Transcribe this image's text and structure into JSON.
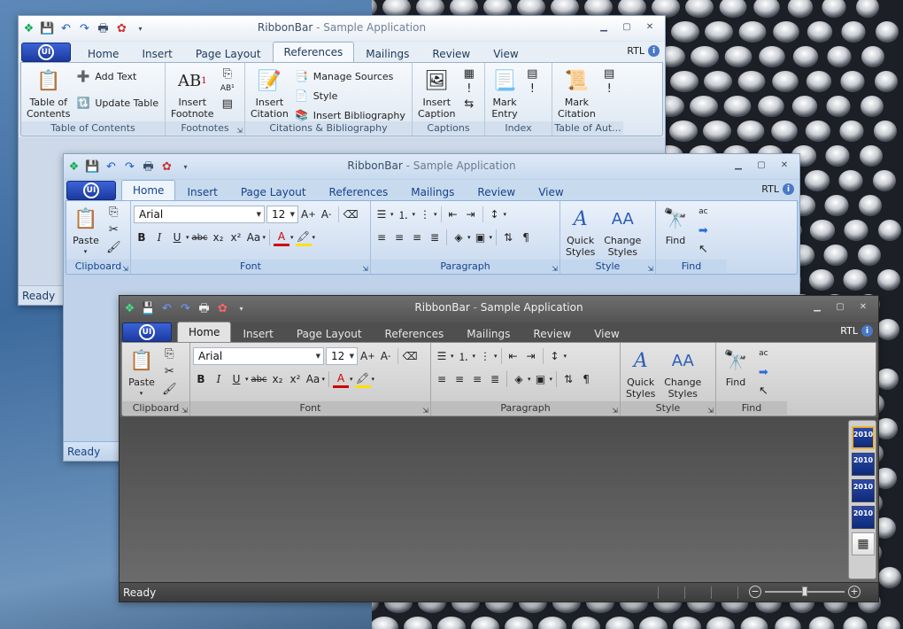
{
  "qat": {
    "icons": [
      "app-icon",
      "save-icon",
      "undo-icon",
      "redo-icon",
      "print-icon",
      "ribbon-icon",
      "customize-icon"
    ]
  },
  "w1": {
    "title_app": "RibbonBar",
    "title_sep": " - ",
    "title_doc": "Sample Application",
    "tabs": [
      "Home",
      "Insert",
      "Page Layout",
      "References",
      "Mailings",
      "Review",
      "View"
    ],
    "selected_tab": "References",
    "rtl": "RTL",
    "status": "Ready",
    "groups": {
      "toc": {
        "label": "Table of Contents",
        "big": "Table of\nContents",
        "add_text": "Add Text",
        "update_table": "Update Table"
      },
      "footnotes": {
        "label": "Footnotes",
        "big": "Insert\nFootnote"
      },
      "citations": {
        "label": "Citations & Bibliography",
        "big": "Insert\nCitation",
        "manage_sources": "Manage Sources",
        "style": "Style",
        "insert_bibliography": "Insert Bibliography"
      },
      "captions": {
        "label": "Captions",
        "big": "Insert\nCaption"
      },
      "index": {
        "label": "Index",
        "big": "Mark\nEntry"
      },
      "toa": {
        "label": "Table of Aut...",
        "big": "Mark\nCitation"
      }
    }
  },
  "w2": {
    "title_app": "RibbonBar",
    "title_sep": " - ",
    "title_doc": "Sample Application",
    "tabs": [
      "Home",
      "Insert",
      "Page Layout",
      "References",
      "Mailings",
      "Review",
      "View"
    ],
    "selected_tab": "Home",
    "rtl": "RTL",
    "status": "Ready"
  },
  "w3": {
    "title_app": "RibbonBar",
    "title_sep": " - ",
    "title_doc": "Sample Application",
    "tabs": [
      "Home",
      "Insert",
      "Page Layout",
      "References",
      "Mailings",
      "Review",
      "View"
    ],
    "selected_tab": "Home",
    "rtl": "RTL",
    "status": "Ready",
    "style_badges": [
      "2010",
      "2010",
      "2010",
      "2010"
    ]
  },
  "home": {
    "paste": "Paste",
    "clipboard": "Clipboard",
    "font_name": "Arial",
    "font_size": "12",
    "font": "Font",
    "paragraph": "Paragraph",
    "quick_styles": "Quick\nStyles",
    "change_styles": "Change\nStyles",
    "style": "Style",
    "find_btn": "Find",
    "find_group": "Find"
  },
  "colors": {
    "font_color": "#d00000",
    "highlight": "#ffe000",
    "orb": "#2447b5"
  }
}
